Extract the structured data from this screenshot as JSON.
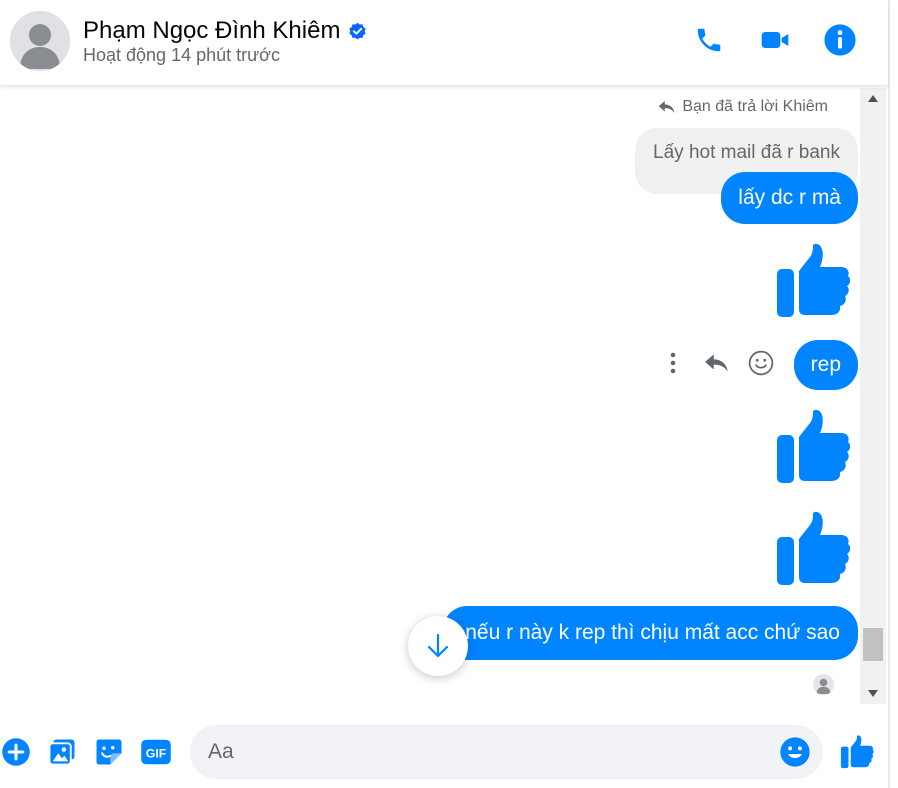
{
  "header": {
    "name": "Phạm Ngọc Đình Khiêm",
    "status": "Hoạt động 14 phút trước"
  },
  "conversation": {
    "reply_note": "Bạn đã trả lời Khiêm",
    "quoted_message": "Lấy hot mail đã r bank",
    "messages": [
      {
        "type": "text",
        "text": "lấy dc r mà"
      },
      {
        "type": "like"
      },
      {
        "type": "text",
        "text": "rep"
      },
      {
        "type": "like"
      },
      {
        "type": "like"
      },
      {
        "type": "text",
        "text": "nếu r này k rep thì chịu mất acc chứ sao"
      }
    ]
  },
  "composer": {
    "placeholder": "Aa"
  },
  "icons": {
    "call": "phone-icon",
    "video": "video-camera-icon",
    "info": "info-icon",
    "more": "more-vertical-icon",
    "reply": "reply-icon",
    "react": "smiley-icon",
    "add": "plus-circle-icon",
    "image": "image-icon",
    "sticker": "sticker-icon",
    "gif": "gif-icon",
    "emoji": "emoji-icon",
    "like": "thumbs-up-icon"
  },
  "colors": {
    "accent": "#0084ff",
    "bubble_text": "#ffffff",
    "quoted_bg": "#f0f0f0",
    "secondary_text": "#65676b"
  }
}
